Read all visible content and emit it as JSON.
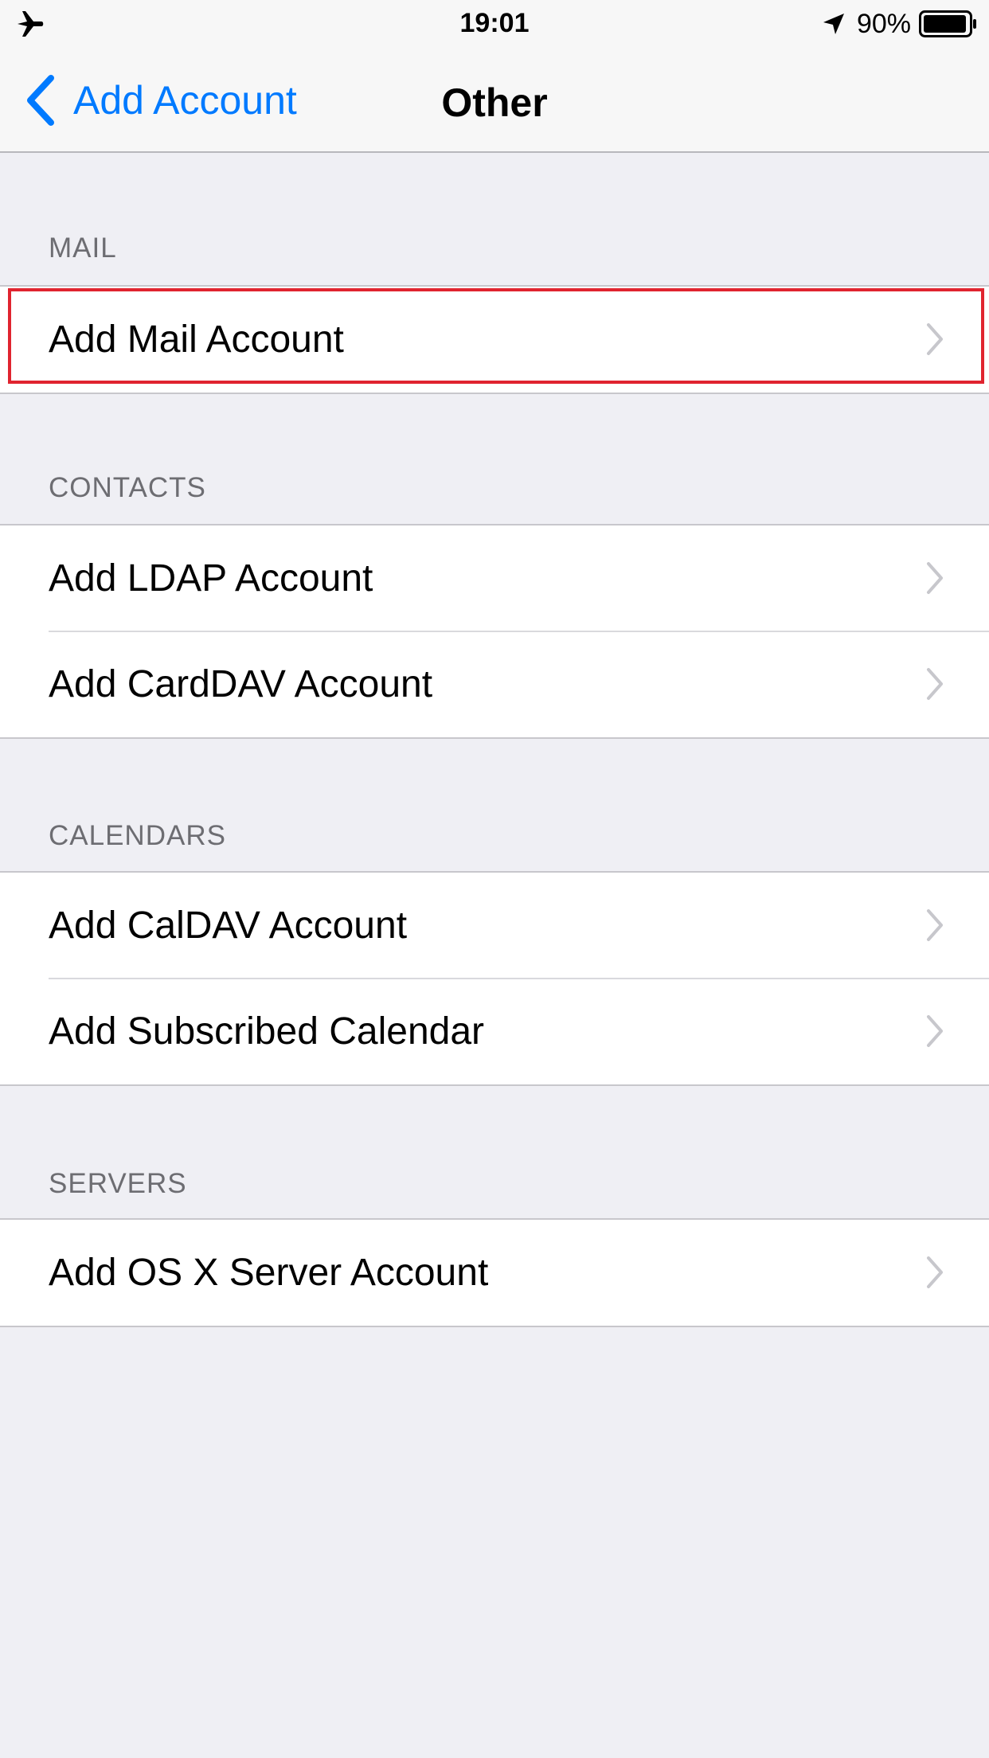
{
  "status_bar": {
    "time": "19:01",
    "battery_percent": "90%",
    "icons": [
      "airplane-icon",
      "location-arrow-icon",
      "battery-icon"
    ]
  },
  "nav": {
    "back_label": "Add Account",
    "title": "Other"
  },
  "colors": {
    "accent": "#007aff",
    "background": "#efeff4",
    "highlight": "#e0242f",
    "section_header": "#6d6d72",
    "chevron": "#c7c7cc"
  },
  "sections": [
    {
      "header": "MAIL",
      "rows": [
        {
          "label": "Add Mail Account",
          "highlighted": true
        }
      ]
    },
    {
      "header": "CONTACTS",
      "rows": [
        {
          "label": "Add LDAP Account"
        },
        {
          "label": "Add CardDAV Account"
        }
      ]
    },
    {
      "header": "CALENDARS",
      "rows": [
        {
          "label": "Add CalDAV Account"
        },
        {
          "label": "Add Subscribed Calendar"
        }
      ]
    },
    {
      "header": "SERVERS",
      "rows": [
        {
          "label": "Add OS X Server Account"
        }
      ]
    }
  ]
}
